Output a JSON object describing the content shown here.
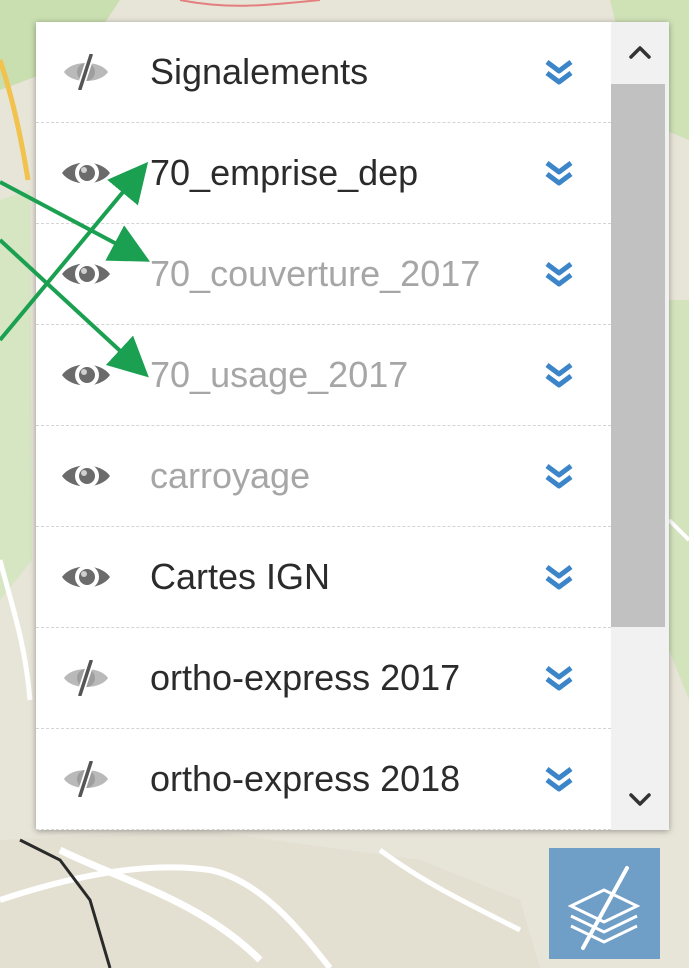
{
  "layers": [
    {
      "label": "Signalements",
      "visible": false,
      "active": true
    },
    {
      "label": "70_emprise_dep",
      "visible": true,
      "active": true
    },
    {
      "label": "70_couverture_2017",
      "visible": true,
      "active": false
    },
    {
      "label": "70_usage_2017",
      "visible": true,
      "active": false
    },
    {
      "label": "carroyage",
      "visible": true,
      "active": false
    },
    {
      "label": "Cartes IGN",
      "visible": true,
      "active": true
    },
    {
      "label": "ortho-express 2017",
      "visible": false,
      "active": true
    },
    {
      "label": "ortho-express 2018",
      "visible": false,
      "active": true
    }
  ],
  "icons": {
    "visible": "eye-icon",
    "hidden": "eye-slash-icon",
    "expand": "double-chevron-down-icon",
    "scroll_up": "chevron-up-icon",
    "scroll_down": "chevron-down-icon",
    "layers": "layers-icon"
  },
  "colors": {
    "annotation_arrow": "#1aa050",
    "chevron": "#3c85c8",
    "layers_button": "#6f9ec6",
    "label_active": "#2b2b2b",
    "label_inactive": "#a6a6a6"
  }
}
